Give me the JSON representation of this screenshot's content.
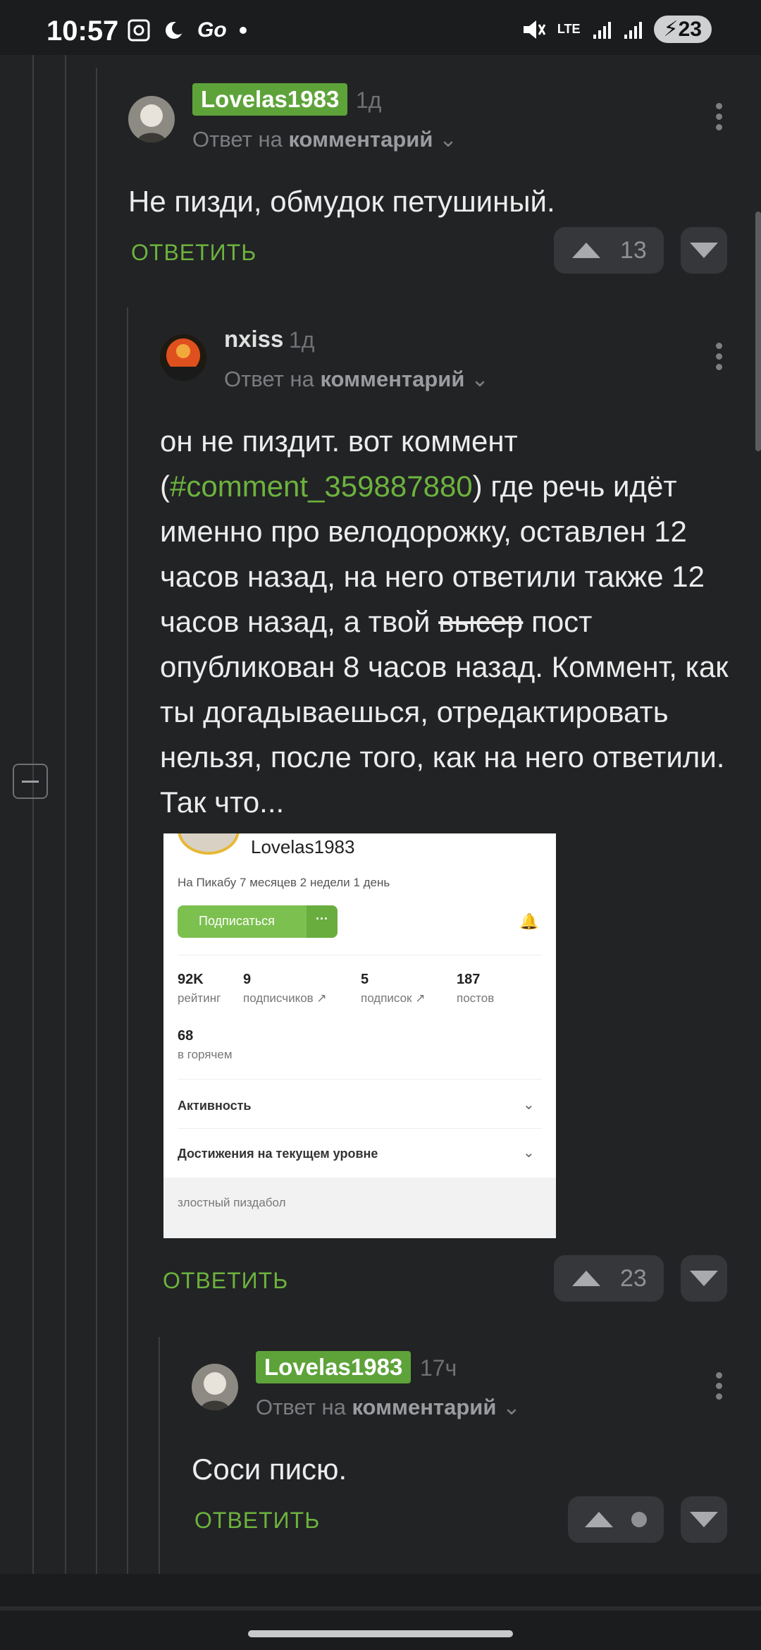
{
  "status_bar": {
    "time": "10:57",
    "network": "LTE",
    "battery": "23"
  },
  "comments": [
    {
      "author": "Lovelas1983",
      "age": "1д",
      "reply_prefix": "Ответ на",
      "reply_target": "комментарий",
      "text": "Не пизди, обмудок петушиный.",
      "reply_label": "ОТВЕТИТЬ",
      "votes": "13"
    },
    {
      "author": "nxiss",
      "age": "1д",
      "reply_prefix": "Ответ на",
      "reply_target": "комментарий",
      "text_1": "он не пиздит. вот коммент (",
      "link": "#comment_359887880",
      "text_2": ") где речь идёт именно про велодорожку, оставлен 12 часов назад, на него ответили также 12 часов назад, а твой ",
      "struck": "высер",
      "text_3": " пост опубликован 8 часов назад. Коммент, как ты догадываешься, отредактировать нельзя, после того, как на него ответили. Так что...",
      "reply_label": "ОТВЕТИТЬ",
      "votes": "23"
    },
    {
      "author": "Lovelas1983",
      "age": "17ч",
      "reply_prefix": "Ответ на",
      "reply_target": "комментарий",
      "text": "Соси писю.",
      "reply_label": "ОТВЕТИТЬ",
      "votes": ""
    }
  ],
  "screenshot": {
    "name": "Lovelas1983",
    "since": "На Пикабу 7 месяцев 2 недели 1 день",
    "subscribe": "Подписаться",
    "more": "···",
    "stats": [
      {
        "value": "92K",
        "label": "рейтинг"
      },
      {
        "value": "9",
        "label": "подписчиков"
      },
      {
        "value": "5",
        "label": "подписок"
      },
      {
        "value": "187",
        "label": "постов"
      },
      {
        "value": "68",
        "label": "в горячем"
      }
    ],
    "row_activity": "Активность",
    "row_achievements": "Достижения на текущем уровне",
    "footer": "злостный пиздабол"
  }
}
